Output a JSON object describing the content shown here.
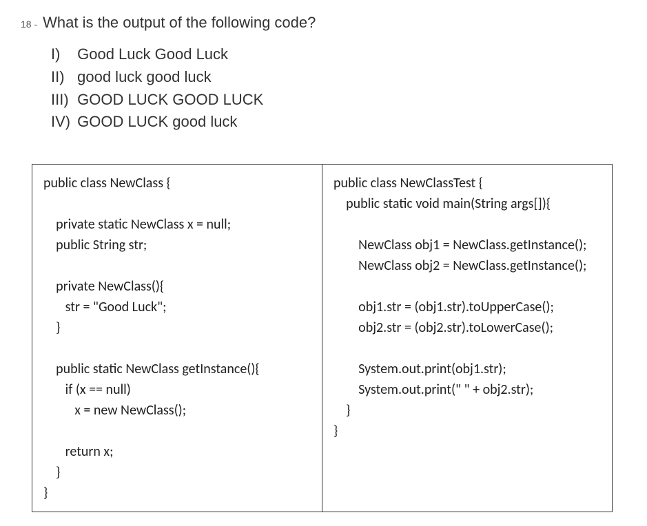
{
  "question": {
    "number": "18 -",
    "text": "What is the output of the following code?"
  },
  "options": [
    {
      "label": "I)",
      "text": "Good Luck Good Luck"
    },
    {
      "label": "II)",
      "text": "good luck good luck"
    },
    {
      "label": "III)",
      "text": "GOOD LUCK GOOD LUCK"
    },
    {
      "label": "IV)",
      "text": "GOOD LUCK good luck"
    }
  ],
  "code": {
    "left": "public class NewClass {\n\n    private static NewClass x = null;\n    public String str;\n\n    private NewClass(){\n       str = \"Good Luck\";\n    }\n\n    public static NewClass getInstance(){\n       if (x == null)\n          x = new NewClass();\n\n       return x;\n    }\n}",
    "right": "public class NewClassTest {\n    public static void main(String args[]){\n\n        NewClass obj1 = NewClass.getInstance();\n        NewClass obj2 = NewClass.getInstance();\n\n        obj1.str = (obj1.str).toUpperCase();\n        obj2.str = (obj2.str).toLowerCase();\n\n        System.out.print(obj1.str);\n        System.out.print(\" \" + obj2.str);\n    }\n}"
  }
}
